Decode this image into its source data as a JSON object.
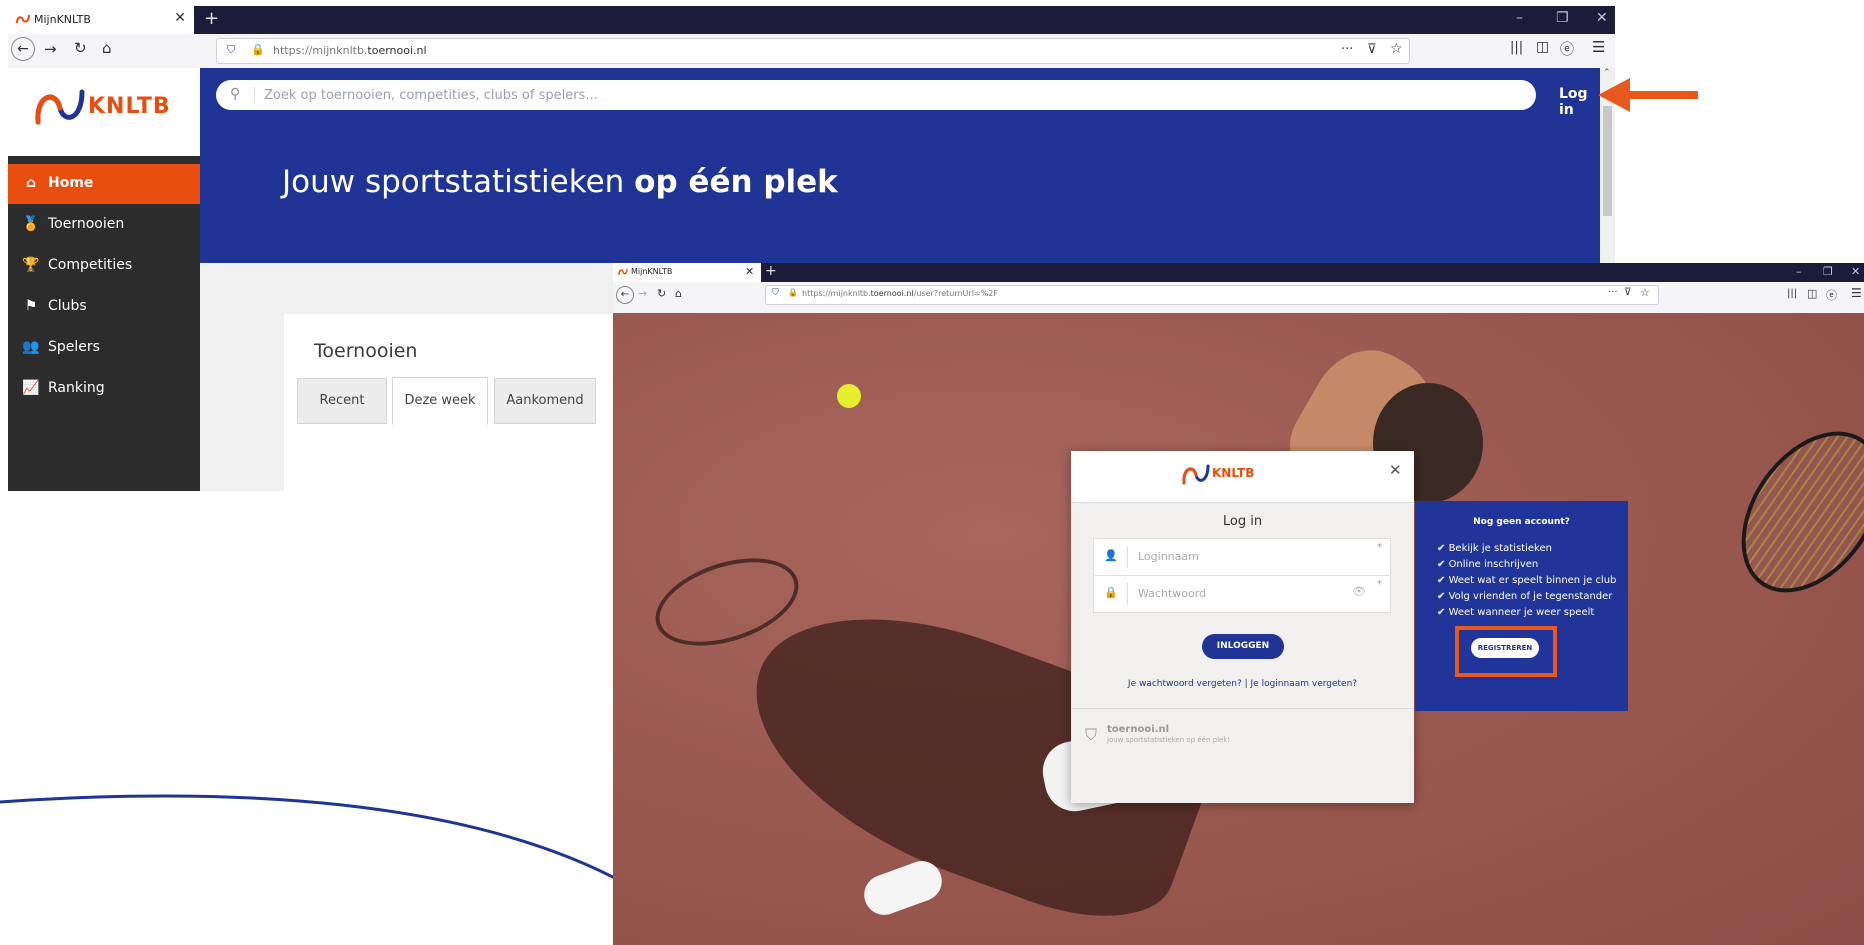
{
  "browser_main": {
    "tab_title": "MijnKNLTB",
    "url_prefix": "https://mijnknltb.",
    "url_domain": "toernooi.nl",
    "logo_text": "KNLTB",
    "search_placeholder": "Zoek op toernooien, competities, clubs of spelers...",
    "login_link": "Log in",
    "hero_title_regular": "Jouw sportstatistieken ",
    "hero_title_bold": "op één plek",
    "sidebar": [
      {
        "label": "Home",
        "icon": "home-icon",
        "active": true
      },
      {
        "label": "Toernooien",
        "icon": "medal-icon"
      },
      {
        "label": "Competities",
        "icon": "trophy-icon"
      },
      {
        "label": "Clubs",
        "icon": "flag-icon"
      },
      {
        "label": "Spelers",
        "icon": "users-icon"
      },
      {
        "label": "Ranking",
        "icon": "chart-icon"
      }
    ],
    "card_title": "Toernooien",
    "tabs": [
      "Recent",
      "Deze week",
      "Aankomend"
    ]
  },
  "browser_login": {
    "tab_title": "MijnKNLTB",
    "url_prefix": "https://mijnknltb.",
    "url_domain": "toernooi.nl",
    "url_suffix": "/user?returnUrl=%2F",
    "modal": {
      "logo_text": "KNLTB",
      "title": "Log in",
      "username_placeholder": "Loginnaam",
      "password_placeholder": "Wachtwoord",
      "submit_label": "INLOGGEN",
      "forgot_password": "Je wachtwoord vergeten?",
      "separator": "|",
      "forgot_username": "Je loginnaam vergeten?",
      "footer_brand": "toernooi.nl",
      "footer_tagline": "jouw sportstatistieken op één plek!"
    },
    "register_panel": {
      "heading": "Nog geen account?",
      "benefits": [
        "Bekijk je statistieken",
        "Online inschrijven",
        "Weet wat er speelt binnen je club",
        "Volg vrienden of je tegenstander",
        "Weet wanneer je weer speelt"
      ],
      "register_label": "REGISTREREN"
    }
  },
  "colors": {
    "brand_blue": "#1f3494",
    "brand_orange": "#e84e0f",
    "annotation_orange": "#e8581c",
    "sidebar_dark": "#2c2c2c",
    "court": "#9b5a51"
  }
}
